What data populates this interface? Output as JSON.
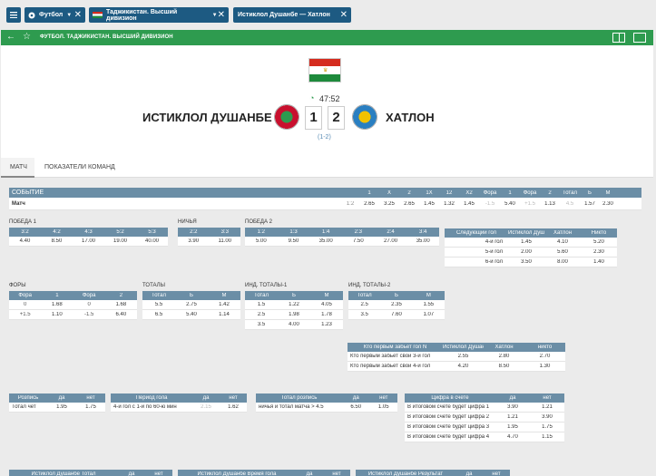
{
  "tabs": [
    {
      "label": "Футбол",
      "icon": "soccer-ball-icon"
    },
    {
      "label": "Таджикистан. Высший дивизион",
      "icon": "tajikistan-flag-icon"
    },
    {
      "label": "Истиклол Душанбе — Хатлон",
      "icon": ""
    }
  ],
  "header": {
    "title": "ФУТБОЛ. ТАДЖИКИСТАН. ВЫСШИЙ ДИВИЗИОН"
  },
  "match": {
    "time": "47:52",
    "home": "ИСТИКЛОЛ ДУШАНБЕ",
    "away": "ХАТЛОН",
    "home_score": "1",
    "away_score": "2",
    "half": "(1-2)"
  },
  "subtabs": [
    "МАТЧ",
    "ПОКАЗАТЕЛИ КОМАНД"
  ],
  "main_table": {
    "headers": [
      "СОБЫТИЕ",
      "1",
      "X",
      "2",
      "1X",
      "12",
      "X2",
      "Фора",
      "1",
      "Фора",
      "2",
      "Тотал",
      "Б",
      "М"
    ],
    "row": [
      "Матч",
      "1:2",
      "2.65",
      "3.25",
      "2.65",
      "1.45",
      "1.32",
      "1.45",
      "-1.5",
      "5.40",
      "+1.5",
      "1.13",
      "4.5",
      "1.57",
      "2.30"
    ]
  },
  "win1": {
    "title": "ПОБЕДА 1",
    "headers": [
      "3:2",
      "4:2",
      "4:3",
      "5:2",
      "5:3"
    ],
    "row": [
      "4.40",
      "8.50",
      "17.00",
      "19.00",
      "40.00"
    ]
  },
  "draw": {
    "title": "НИЧЬЯ",
    "headers": [
      "2:2",
      "3:3"
    ],
    "row": [
      "3.90",
      "11.00"
    ]
  },
  "win2": {
    "title": "ПОБЕДА 2",
    "headers": [
      "1:2",
      "1:3",
      "1:4",
      "2:3",
      "2:4",
      "3:4"
    ],
    "row": [
      "5.00",
      "9.50",
      "35.00",
      "7.50",
      "27.00",
      "35.00"
    ]
  },
  "next_goal": {
    "headers": [
      "Следующий гол",
      "Истиклол Душанбе",
      "Хатлон",
      "Никто"
    ],
    "rows": [
      [
        "4-й гол",
        "1.45",
        "4.10",
        "5.20"
      ],
      [
        "5-й гол",
        "2.00",
        "5.60",
        "2.30"
      ],
      [
        "6-й гол",
        "3.50",
        "8.00",
        "1.40"
      ]
    ]
  },
  "fora": {
    "title": "ФОРЫ",
    "headers": [
      "Фора",
      "1",
      "Фора",
      "2"
    ],
    "rows": [
      [
        "0",
        "1.68",
        "0",
        "1.68"
      ],
      [
        "+1.5",
        "1.10",
        "-1.5",
        "6.40"
      ]
    ]
  },
  "totals": {
    "title": "ТОТАЛЫ",
    "headers": [
      "Тотал",
      "Б",
      "М"
    ],
    "rows": [
      [
        "5.5",
        "2.75",
        "1.42"
      ],
      [
        "6.5",
        "5.40",
        "1.14"
      ]
    ]
  },
  "ind1": {
    "title": "ИНД. ТОТАЛЫ-1",
    "headers": [
      "Тотал",
      "Б",
      "М"
    ],
    "rows": [
      [
        "1.5",
        "1.22",
        "4.05"
      ],
      [
        "2.5",
        "1.98",
        "1.78"
      ],
      [
        "3.5",
        "4.00",
        "1.23"
      ]
    ]
  },
  "ind2": {
    "title": "ИНД. ТОТАЛЫ-2",
    "headers": [
      "Тотал",
      "Б",
      "М"
    ],
    "rows": [
      [
        "2.5",
        "2.35",
        "1.55"
      ],
      [
        "3.5",
        "7.60",
        "1.07"
      ]
    ]
  },
  "first_goal": {
    "headers": [
      "Кто первым забьет гол N",
      "Истиклол Душанбе",
      "Хатлон",
      "никто"
    ],
    "rows": [
      [
        "Кто первым забьет свой 3-й гол",
        "2.55",
        "2.80",
        "2.70"
      ],
      [
        "Кто первым забьет свой 4-й гол",
        "4.20",
        "8.50",
        "1.30"
      ]
    ]
  },
  "draw_result": {
    "headers": [
      "Розпись",
      "да",
      "нет"
    ],
    "row": [
      "Тотал чет",
      "1.95",
      "1.75"
    ]
  },
  "period_goal": {
    "headers": [
      "Период гола",
      "да",
      "нет"
    ],
    "row": [
      "4-й гол с 1-й по 60-ю мин",
      "2.15",
      "1.62"
    ]
  },
  "total_draw": {
    "headers": [
      "Тотал розпись",
      "да",
      "нет"
    ],
    "row": [
      "ничья и тотал матча > 4.5",
      "6.50",
      "1.05"
    ]
  },
  "digit_score": {
    "headers": [
      "Цифра в счете",
      "да",
      "нет"
    ],
    "rows": [
      [
        "В итоговом счете будет цифра 1",
        "3.90",
        "1.21"
      ],
      [
        "В итоговом счете будет цифра 2",
        "1.21",
        "3.90"
      ],
      [
        "В итоговом счете будет цифра 3",
        "1.95",
        "1.75"
      ],
      [
        "В итоговом счете будет цифра 4",
        "4.70",
        "1.15"
      ]
    ]
  },
  "bottom": [
    "Истиклол Душанбе Тотал",
    "да",
    "нет",
    "Истиклол Душанбе Время гола",
    "да",
    "нет",
    "Истиклол Душанбе Результат",
    "да",
    "нет"
  ],
  "colors": {
    "tab": "#1d5a82",
    "header": "#2e9b4f",
    "thead": "#6b8ea6"
  }
}
